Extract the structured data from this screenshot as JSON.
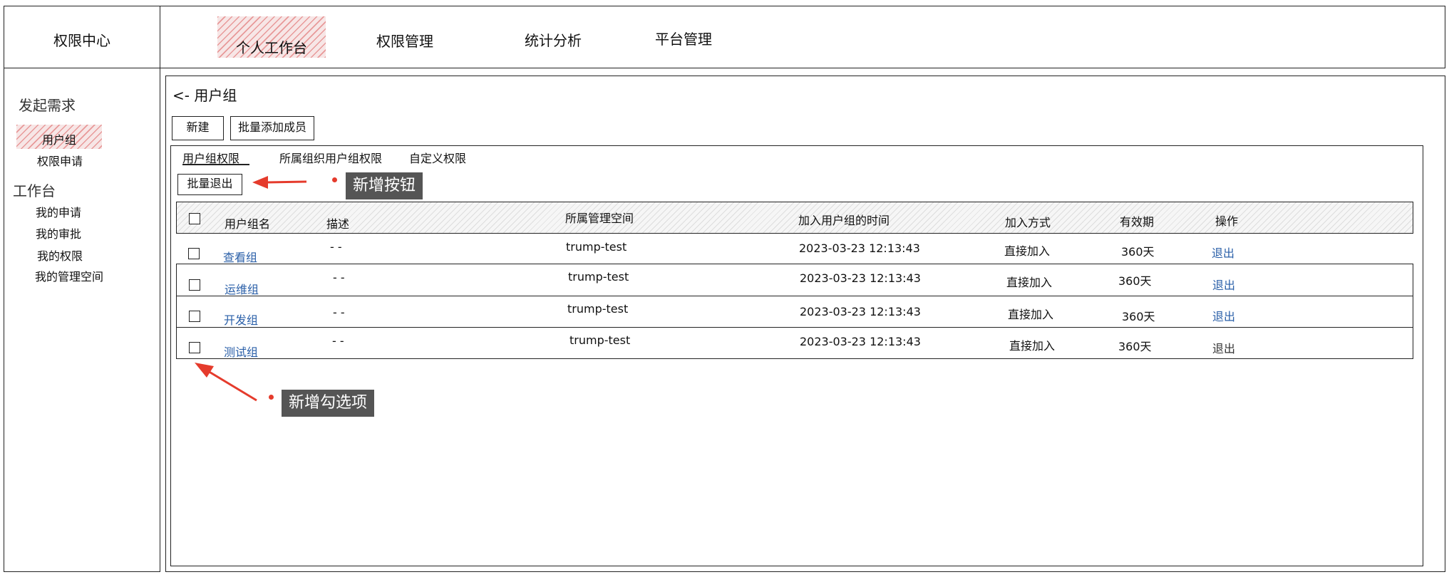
{
  "app": {
    "title": "权限中心"
  },
  "nav": {
    "items": [
      {
        "label": "个人工作台",
        "active": true
      },
      {
        "label": "权限管理"
      },
      {
        "label": "统计分析"
      },
      {
        "label": "平台管理"
      }
    ]
  },
  "sidebar": {
    "sections": [
      {
        "label": "发起需求",
        "items": [
          {
            "label": "用户组",
            "active": true
          },
          {
            "label": "权限申请"
          }
        ]
      },
      {
        "label": "工作台",
        "items": [
          {
            "label": "我的申请"
          },
          {
            "label": "我的审批"
          },
          {
            "label": "我的权限"
          },
          {
            "label": "我的管理空间"
          }
        ]
      }
    ]
  },
  "main": {
    "breadcrumb": "<- 用户组",
    "buttons": {
      "new": "新建",
      "batch_add": "批量添加成员"
    },
    "tabs": [
      {
        "label": "用户组权限",
        "active": true
      },
      {
        "label": "所属组织用户组权限"
      },
      {
        "label": "自定义权限"
      }
    ],
    "batch_exit": "批量退出",
    "table": {
      "headers": [
        "用户组名",
        "描述",
        "所属管理空间",
        "加入用户组的时间",
        "加入方式",
        "有效期",
        "操作"
      ],
      "rows": [
        {
          "name": "查看组",
          "desc": "- -",
          "space": "trump-test",
          "time": "2023-03-23 12:13:43",
          "method": "直接加入",
          "validity": "360天",
          "action": "退出",
          "action_link": true
        },
        {
          "name": "运维组",
          "desc": "- -",
          "space": "trump-test",
          "time": "2023-03-23 12:13:43",
          "method": "直接加入",
          "validity": "360天",
          "action": "退出",
          "action_link": true
        },
        {
          "name": "开发组",
          "desc": "- -",
          "space": "trump-test",
          "time": "2023-03-23 12:13:43",
          "method": "直接加入",
          "validity": "360天",
          "action": "退出",
          "action_link": true
        },
        {
          "name": "测试组",
          "desc": "- -",
          "space": "trump-test",
          "time": "2023-03-23 12:13:43",
          "method": "直接加入",
          "validity": "360天",
          "action": "退出",
          "action_link": false
        }
      ]
    }
  },
  "annotations": {
    "new_button": "新增按钮",
    "new_checkbox": "新增勾选项"
  },
  "colors": {
    "link": "#2a5fa8",
    "highlight": "#f2c9c9",
    "callout_bg": "#555555",
    "arrow": "#e53b2c"
  }
}
